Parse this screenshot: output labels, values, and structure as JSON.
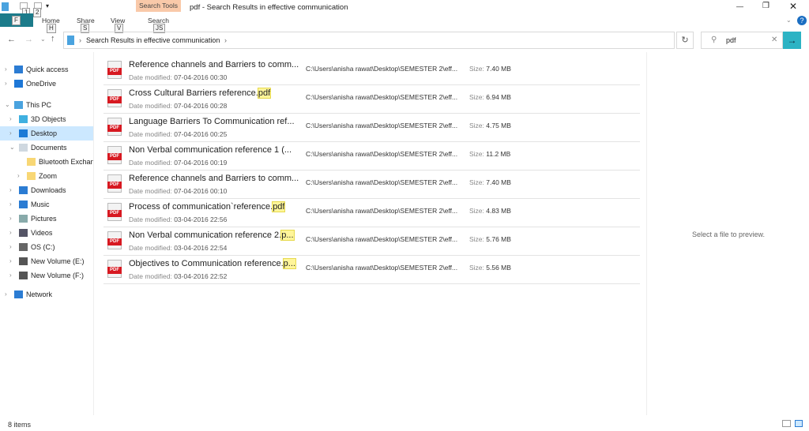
{
  "window": {
    "title": "pdf - Search Results in effective communication",
    "min": "—",
    "max": "❐",
    "close": "✕"
  },
  "qat": {
    "keys": [
      "1",
      "2"
    ]
  },
  "ribbon": {
    "file_key": "F",
    "tabs": [
      {
        "label": "Home",
        "key": "H"
      },
      {
        "label": "Share",
        "key": "S"
      },
      {
        "label": "View",
        "key": "V"
      },
      {
        "label": "Search",
        "key": "JS"
      }
    ],
    "context": "Search Tools"
  },
  "address": {
    "path": "Search Results in effective communication"
  },
  "search": {
    "value": "pdf"
  },
  "nav": [
    {
      "label": "Quick access",
      "level": 0,
      "chev": ">",
      "icon": "star-icon",
      "color": "#2b7cd3"
    },
    {
      "label": "OneDrive",
      "level": 0,
      "chev": ">",
      "icon": "cloud-icon",
      "color": "#1e78d7"
    },
    {
      "label": "This PC",
      "level": 0,
      "chev": "v",
      "icon": "computer-icon",
      "color": "#4aa3df"
    },
    {
      "label": "3D Objects",
      "level": 1,
      "chev": ">",
      "icon": "cube-icon",
      "color": "#3fb0e0"
    },
    {
      "label": "Desktop",
      "level": 1,
      "chev": ">",
      "icon": "desktop-icon",
      "color": "#1b7ad6",
      "selected": true
    },
    {
      "label": "Documents",
      "level": 1,
      "chev": "v",
      "icon": "document-icon",
      "color": "#cfd8e0"
    },
    {
      "label": "Bluetooth Exchange",
      "level": 2,
      "chev": "",
      "icon": "folder-icon",
      "color": "#f8d775"
    },
    {
      "label": "Zoom",
      "level": 2,
      "chev": ">",
      "icon": "folder-icon",
      "color": "#f8d775"
    },
    {
      "label": "Downloads",
      "level": 1,
      "chev": ">",
      "icon": "download-icon",
      "color": "#2b7cd3"
    },
    {
      "label": "Music",
      "level": 1,
      "chev": ">",
      "icon": "music-icon",
      "color": "#2b7cd3"
    },
    {
      "label": "Pictures",
      "level": 1,
      "chev": ">",
      "icon": "pictures-icon",
      "color": "#8aa"
    },
    {
      "label": "Videos",
      "level": 1,
      "chev": ">",
      "icon": "video-icon",
      "color": "#556"
    },
    {
      "label": "OS (C:)",
      "level": 1,
      "chev": ">",
      "icon": "drive-icon",
      "color": "#666"
    },
    {
      "label": "New Volume (E:)",
      "level": 1,
      "chev": ">",
      "icon": "drive-icon",
      "color": "#555"
    },
    {
      "label": "New Volume (F:)",
      "level": 1,
      "chev": ">",
      "icon": "drive-icon",
      "color": "#555"
    },
    {
      "label": "Network",
      "level": 0,
      "chev": ">",
      "icon": "network-icon",
      "color": "#2b7cd3"
    }
  ],
  "labels": {
    "date": "Date modified:",
    "size": "Size:"
  },
  "files": [
    {
      "name": "Reference channels and Barriers to comm...",
      "hl": "",
      "date": "07-04-2016 00:30",
      "path": "C:\\Users\\anisha rawat\\Desktop\\SEMESTER 2\\eff...",
      "size": "7.40 MB"
    },
    {
      "name": "Cross Cultural Barriers reference.",
      "hl": "pdf",
      "date": "07-04-2016 00:28",
      "path": "C:\\Users\\anisha rawat\\Desktop\\SEMESTER 2\\eff...",
      "size": "6.94 MB"
    },
    {
      "name": "Language Barriers To Communication ref...",
      "hl": "",
      "date": "07-04-2016 00:25",
      "path": "C:\\Users\\anisha rawat\\Desktop\\SEMESTER 2\\eff...",
      "size": "4.75 MB"
    },
    {
      "name": "Non Verbal communication reference  1 (...",
      "hl": "",
      "date": "07-04-2016 00:19",
      "path": "C:\\Users\\anisha rawat\\Desktop\\SEMESTER 2\\eff...",
      "size": "11.2 MB"
    },
    {
      "name": "Reference channels and Barriers to comm...",
      "hl": "",
      "date": "07-04-2016 00:10",
      "path": "C:\\Users\\anisha rawat\\Desktop\\SEMESTER 2\\eff...",
      "size": "7.40 MB"
    },
    {
      "name": "Process of communication`reference.",
      "hl": "pdf",
      "date": "03-04-2016 22:56",
      "path": "C:\\Users\\anisha rawat\\Desktop\\SEMESTER 2\\eff...",
      "size": "4.83 MB"
    },
    {
      "name": "Non Verbal communication reference  2.",
      "hl": "p...",
      "date": "03-04-2016 22:54",
      "path": "C:\\Users\\anisha rawat\\Desktop\\SEMESTER 2\\eff...",
      "size": "5.76 MB"
    },
    {
      "name": "Objectives to Communication reference.",
      "hl": "p...",
      "date": "03-04-2016 22:52",
      "path": "C:\\Users\\anisha rawat\\Desktop\\SEMESTER 2\\eff...",
      "size": "5.56 MB"
    }
  ],
  "preview": "Select a file to preview.",
  "status": "8 items"
}
